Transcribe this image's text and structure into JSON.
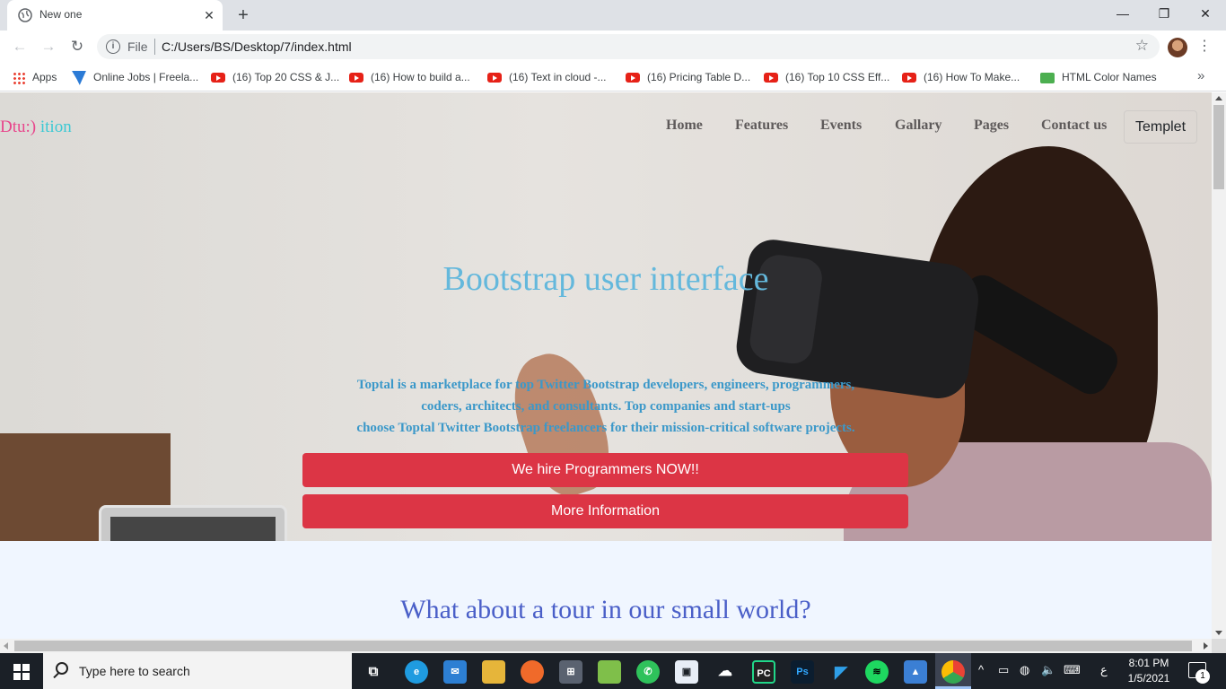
{
  "browser": {
    "tab_title": "New one",
    "tab_close": "✕",
    "new_tab": "+",
    "scheme_label": "File",
    "url": "C:/Users/BS/Desktop/7/index.html",
    "bookmarks": [
      {
        "label": "Apps",
        "icon": "apps-grid-icon"
      },
      {
        "label": "Online Jobs | Freela...",
        "icon": "freelancer-icon"
      },
      {
        "label": "(16) Top 20 CSS & J...",
        "icon": "youtube-icon"
      },
      {
        "label": "(16) How to build a...",
        "icon": "youtube-icon"
      },
      {
        "label": "(16) Text in cloud -...",
        "icon": "youtube-icon"
      },
      {
        "label": "(16) Pricing Table D...",
        "icon": "youtube-icon"
      },
      {
        "label": "(16) Top 10 CSS Eff...",
        "icon": "youtube-icon"
      },
      {
        "label": "(16) How To Make...",
        "icon": "youtube-icon"
      },
      {
        "label": "HTML Color Names",
        "icon": "w3schools-icon"
      }
    ],
    "bookmarks_more": "»"
  },
  "page": {
    "brand_part1": "Dtu:)",
    "brand_part2": " ition",
    "nav": [
      "Home",
      "Features",
      "Events",
      "Gallary",
      "Pages",
      "Contact us"
    ],
    "templet_button": "Templet",
    "hero_title": "Bootstrap user interface",
    "hero_lines": [
      "Toptal is a marketplace for top Twitter Bootstrap developers, engineers, programmers,",
      "coders, architects, and consultants. Top companies and start-ups",
      "choose Toptal Twitter Bootstrap freelancers for their mission-critical software projects."
    ],
    "hire_button": "We hire Programmers NOW!!",
    "info_button": "More Information",
    "section_title": "What about a tour in our small world?"
  },
  "taskbar": {
    "search_placeholder": "Type here to search",
    "time": "8:01 PM",
    "date": "1/5/2021",
    "lang": "ع",
    "notification_count": "1",
    "apps": [
      "task-view",
      "edge",
      "mail",
      "file-explorer",
      "firefox",
      "store",
      "notepad-plus",
      "whatsapp",
      "app-box",
      "soundcloud",
      "pycharm",
      "photoshop",
      "vscode",
      "spotify",
      "photos",
      "chrome"
    ]
  },
  "colors": {
    "accent_red": "#dc3545",
    "hero_title": "#64b8dc",
    "hero_text": "#3b98c9",
    "section_title": "#4a5fc8",
    "brand_pink": "#e8458b",
    "brand_cyan": "#3bc9d4"
  }
}
